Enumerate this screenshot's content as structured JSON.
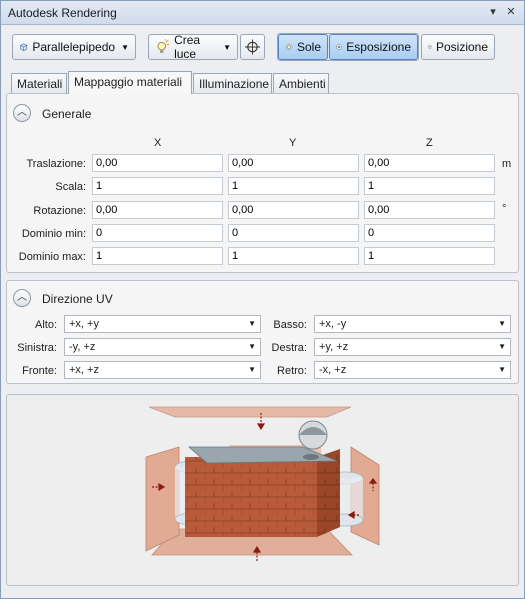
{
  "window": {
    "title": "Autodesk Rendering"
  },
  "toolbar": {
    "mapping_type": "Parallelepipedo",
    "create_light": "Crea luce",
    "sun": "Sole",
    "exposure": "Esposizione",
    "position": "Posizione"
  },
  "tabs": [
    {
      "label": "Materiali"
    },
    {
      "label": "Mappaggio materiali"
    },
    {
      "label": "Illuminazione"
    },
    {
      "label": "Ambienti"
    }
  ],
  "general": {
    "title": "Generale",
    "axes": [
      "X",
      "Y",
      "Z"
    ],
    "rows": [
      {
        "label": "Traslazione:",
        "x": "0,00",
        "y": "0,00",
        "z": "0,00",
        "unit": "m"
      },
      {
        "label": "Scala:",
        "x": "1",
        "y": "1",
        "z": "1",
        "unit": ""
      },
      {
        "label": "Rotazione:",
        "x": "0,00",
        "y": "0,00",
        "z": "0,00",
        "unit": "°"
      },
      {
        "label": "Dominio min:",
        "x": "0",
        "y": "0",
        "z": "0",
        "unit": ""
      },
      {
        "label": "Dominio max:",
        "x": "1",
        "y": "1",
        "z": "1",
        "unit": ""
      }
    ]
  },
  "uv": {
    "title": "Direzione UV",
    "alto_label": "Alto:",
    "alto": "+x, +y",
    "basso_label": "Basso:",
    "basso": "+x, -y",
    "sinistra_label": "Sinistra:",
    "sinistra": "-y, +z",
    "destra_label": "Destra:",
    "destra": "+y, +z",
    "fronte_label": "Fronte:",
    "fronte": "+x, +z",
    "retro_label": "Retro:",
    "retro": "-x, +z"
  },
  "preview": {
    "accent": "#8b1a10"
  }
}
